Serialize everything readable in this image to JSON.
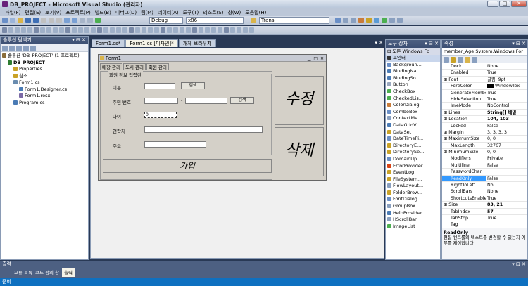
{
  "window": {
    "title": "DB_PROJECT - Microsoft Visual Studio (관리자)"
  },
  "menu": [
    "파일(F)",
    "편집(E)",
    "보기(V)",
    "프로젝트(P)",
    "빌드(B)",
    "디버그(D)",
    "팀(M)",
    "데이터(A)",
    "도구(T)",
    "테스트(S)",
    "창(W)",
    "도움말(H)"
  ],
  "toolbar": {
    "config": "Debug",
    "platform": "x86",
    "find": "Trans"
  },
  "solution": {
    "header": "솔루션 탐색기",
    "items": [
      {
        "label": "솔루션 'DB_PROJECT' (1 프로젝트)",
        "indent": 0,
        "color": "#8a6d3b"
      },
      {
        "label": "DB_PROJECT",
        "indent": 1,
        "color": "#2e7d32",
        "bold": true
      },
      {
        "label": "Properties",
        "indent": 2,
        "color": "#c9a227"
      },
      {
        "label": "참조",
        "indent": 2,
        "color": "#c9a227"
      },
      {
        "label": "Form1.cs",
        "indent": 2,
        "color": "#6a8caf"
      },
      {
        "label": "Form1.Designer.cs",
        "indent": 3,
        "color": "#4a7bb5"
      },
      {
        "label": "Form1.resx",
        "indent": 3,
        "color": "#7b6aa6"
      },
      {
        "label": "Program.cs",
        "indent": 2,
        "color": "#4a7bb5"
      }
    ]
  },
  "editor_tabs": [
    {
      "label": "Form1.cs*",
      "active": false
    },
    {
      "label": "Form1.cs [디자인]*",
      "active": true
    },
    {
      "label": "개체 브라우저",
      "active": false
    }
  ],
  "form": {
    "title": "Form1",
    "tabs": [
      "매장 관리",
      "도서 관리",
      "회원 관리"
    ],
    "group_title": "회원 정보 입력란",
    "labels": {
      "name": "이름",
      "ssn": "주민 번호",
      "age": "나이",
      "phone": "연락처",
      "address": "주소"
    },
    "ssn_dash": "-",
    "search_label": "검색",
    "age_value": "0",
    "edit_label": "수정",
    "delete_label": "삭제",
    "join_label": "가입"
  },
  "toolbox": {
    "header": "도구 상자",
    "category": "모든 Windows Fo",
    "items": [
      "포인터",
      "Backgroun...",
      "BindingNa...",
      "BindingSo...",
      "Button",
      "CheckBox",
      "CheckedLis...",
      "ColorDialog",
      "ComboBox",
      "ContextMe...",
      "DataGridVi...",
      "DataSet",
      "DateTimePi...",
      "DirectoryE...",
      "DirectorySe...",
      "DomainUp...",
      "ErrorProvider",
      "EventLog",
      "FileSystem...",
      "FlowLayout...",
      "FolderBrow...",
      "FontDialog",
      "GroupBox",
      "HelpProvider",
      "HScrollBar",
      "ImageList"
    ]
  },
  "properties": {
    "header": "속성",
    "object": "member_Age System.Windows.For",
    "rows": [
      {
        "k": "Dock",
        "v": "None"
      },
      {
        "k": "Enabled",
        "v": "True"
      },
      {
        "k": "Font",
        "v": "굴림, 9pt",
        "plus": true
      },
      {
        "k": "ForeColor",
        "v": "WindowTex",
        "swatch": true
      },
      {
        "k": "GenerateMembe",
        "v": "True"
      },
      {
        "k": "HideSelection",
        "v": "True"
      },
      {
        "k": "ImeMode",
        "v": "NoControl"
      },
      {
        "k": "Lines",
        "v": "String[] 배열",
        "plus": true,
        "bold": true
      },
      {
        "k": "Location",
        "v": "104, 103",
        "plus": true,
        "bold": true
      },
      {
        "k": "Locked",
        "v": "False"
      },
      {
        "k": "Margin",
        "v": "3, 3, 3, 3",
        "plus": true
      },
      {
        "k": "MaximumSize",
        "v": "0, 0",
        "plus": true
      },
      {
        "k": "MaxLength",
        "v": "32767"
      },
      {
        "k": "MinimumSize",
        "v": "0, 0",
        "plus": true
      },
      {
        "k": "Modifiers",
        "v": "Private"
      },
      {
        "k": "Multiline",
        "v": "False"
      },
      {
        "k": "PasswordChar",
        "v": ""
      },
      {
        "k": "ReadOnly",
        "v": "False",
        "selected": true
      },
      {
        "k": "RightToLeft",
        "v": "No"
      },
      {
        "k": "ScrollBars",
        "v": "None"
      },
      {
        "k": "ShortcutsEnable",
        "v": "True"
      },
      {
        "k": "Size",
        "v": "83, 21",
        "plus": true,
        "bold": true
      },
      {
        "k": "TabIndex",
        "v": "57",
        "bold": true
      },
      {
        "k": "TabStop",
        "v": "True"
      },
      {
        "k": "Tag",
        "v": ""
      }
    ],
    "desc_title": "ReadOnly",
    "desc_text": "편집 컨트롤의 텍스트를 변경할 수 있는지 여부를 제어합니다."
  },
  "output": {
    "header": "출력",
    "tabs": [
      "오류 목록",
      "코드 정의 창",
      "출력"
    ]
  },
  "status": {
    "text": "준비"
  }
}
